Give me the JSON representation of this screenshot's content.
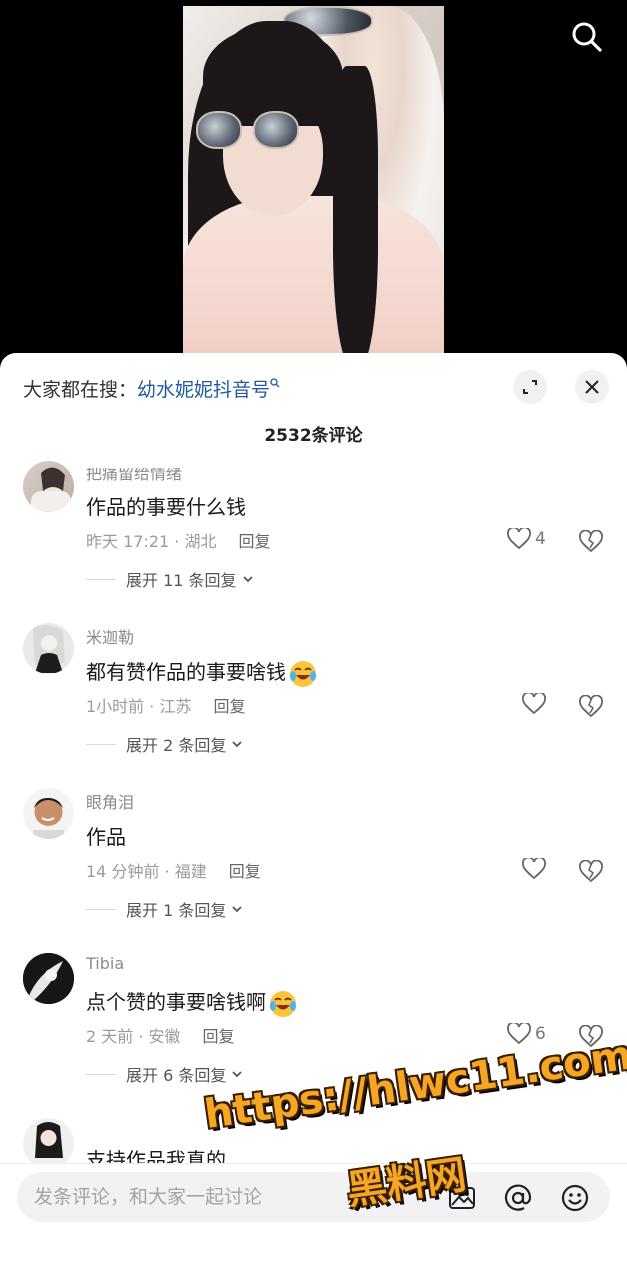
{
  "header": {
    "trending_prefix": "大家都在搜：",
    "trending_keyword": "幼水妮妮抖音号"
  },
  "comments_title": "2532条评论",
  "comments": [
    {
      "username": "把痛留给情绪",
      "text": "作品的事要什么钱",
      "time_location": "昨天 17:21 · 湖北",
      "reply_label": "回复",
      "likes": "4",
      "expand_label": "展开 11 条回复"
    },
    {
      "username": "米迦勒",
      "text": "都有赞作品的事要啥钱",
      "emoji": "laughing-crying-emoji",
      "time_location": "1小时前 · 江苏",
      "reply_label": "回复",
      "likes": "",
      "expand_label": "展开 2 条回复"
    },
    {
      "username": "眼角泪",
      "text": "作品",
      "time_location": "14 分钟前 · 福建",
      "reply_label": "回复",
      "likes": "",
      "expand_label": "展开 1 条回复"
    },
    {
      "username": "Tibia",
      "text": "点个赞的事要啥钱啊",
      "emoji": "laughing-crying-emoji",
      "time_location": "2 天前 · 安徽",
      "reply_label": "回复",
      "likes": "6",
      "expand_label": "展开 6 条回复"
    },
    {
      "username": "",
      "text": "支持作品我真的"
    }
  ],
  "input": {
    "placeholder": "发条评论，和大家一起讨论"
  },
  "watermark": {
    "url": "https://hlwc11.com",
    "name": "黑料网"
  },
  "colors": {
    "keyword": "#1f5a9e",
    "watermark": "#f5a623"
  }
}
